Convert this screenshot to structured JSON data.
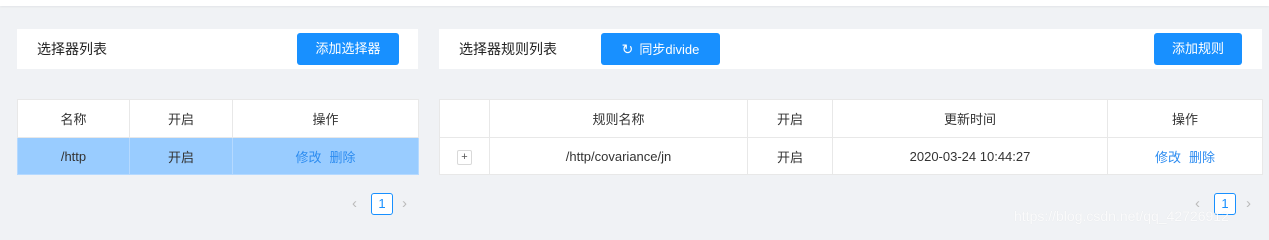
{
  "selector_panel": {
    "title": "选择器列表",
    "add_button": "添加选择器",
    "columns": [
      "名称",
      "开启",
      "操作"
    ],
    "rows": [
      {
        "name": "/http",
        "enabled": "开启",
        "edit": "修改",
        "delete": "删除"
      }
    ],
    "pagination": {
      "prev": "‹",
      "current": "1",
      "next": "›"
    }
  },
  "rule_panel": {
    "title": "选择器规则列表",
    "sync_button": "同步divide",
    "sync_icon": "refresh-icon",
    "add_button": "添加规则",
    "columns": [
      "",
      "规则名称",
      "开启",
      "更新时间",
      "操作"
    ],
    "rows": [
      {
        "expand": "+",
        "name": "/http/covariance/jn",
        "enabled": "开启",
        "updated": "2020-03-24 10:44:27",
        "edit": "修改",
        "delete": "删除"
      }
    ],
    "pagination": {
      "prev": "‹",
      "current": "1",
      "next": "›"
    }
  },
  "watermark": "https://blog.csdn.net/qq_42726912",
  "colors": {
    "primary": "#1890ff",
    "enabled_green": "#19be6b",
    "selected_row": "#99ccff",
    "link": "#2d8cf0"
  }
}
